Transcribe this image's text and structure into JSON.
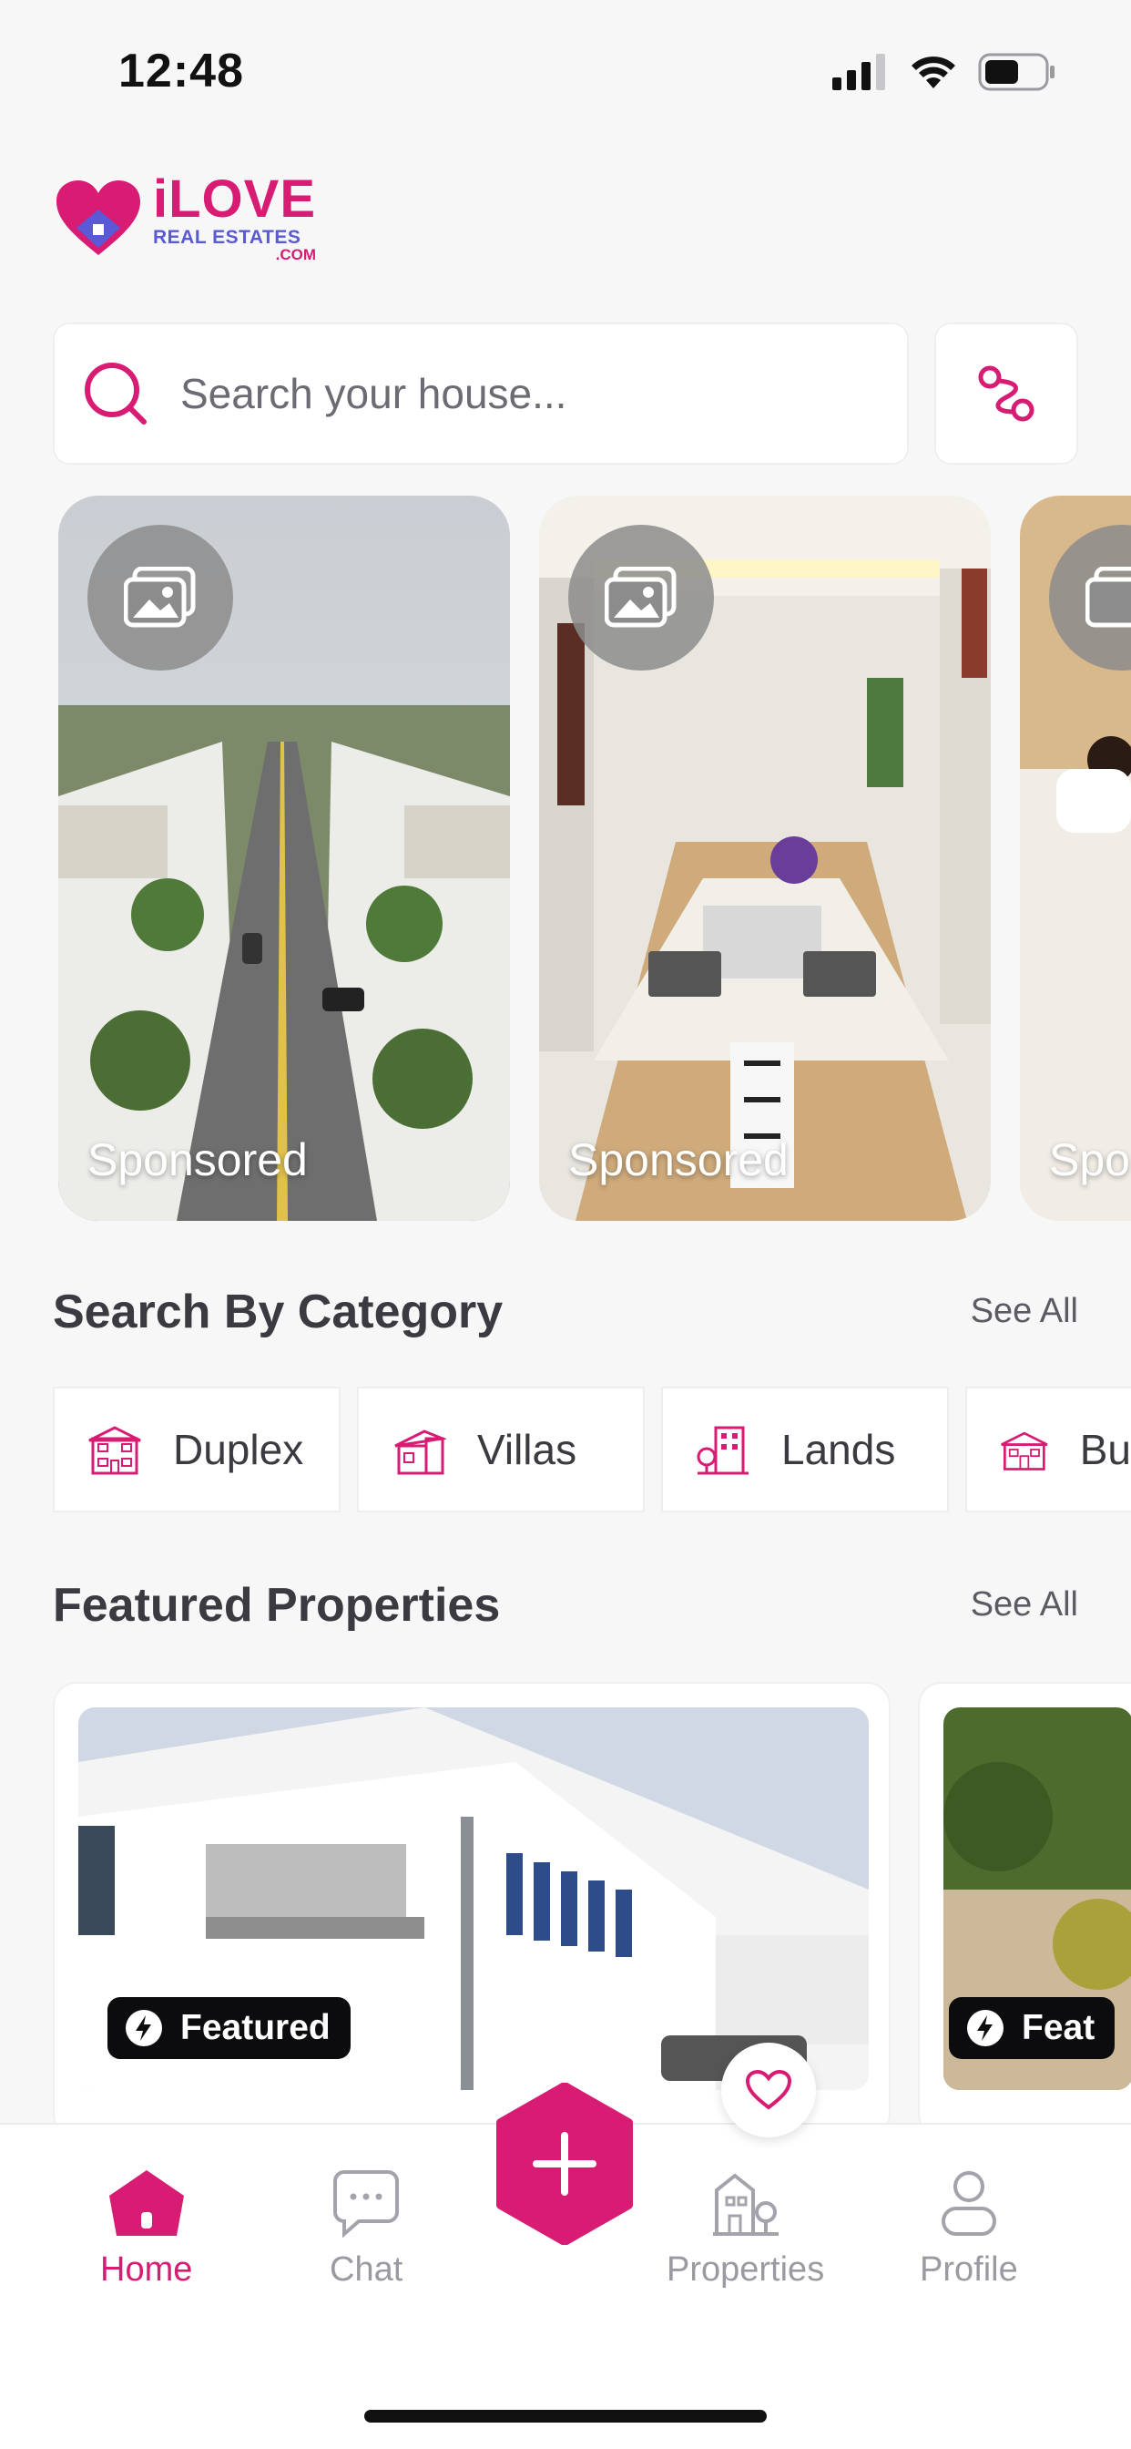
{
  "status_bar": {
    "time": "12:48"
  },
  "brand": {
    "name_main": "iLOVE",
    "name_sub": "REAL ESTATES",
    "name_tld": ".COM",
    "accent": "#d81b73",
    "secondary": "#5a5ad6"
  },
  "search": {
    "placeholder": "Search your house...",
    "icon": "search-icon",
    "filter_icon": "route-icon"
  },
  "sponsored": [
    {
      "label": "Sponsored",
      "icon": "image-icon"
    },
    {
      "label": "Sponsored",
      "icon": "image-icon"
    },
    {
      "label": "Spo",
      "icon": "image-icon"
    }
  ],
  "categories_section": {
    "title": "Search By Category",
    "see_all": "See All",
    "items": [
      {
        "label": "Duplex",
        "icon": "duplex-icon"
      },
      {
        "label": "Villas",
        "icon": "villa-icon"
      },
      {
        "label": "Lands",
        "icon": "land-icon"
      },
      {
        "label": "Bu",
        "icon": "bungalow-icon"
      }
    ]
  },
  "featured_section": {
    "title": "Featured Properties",
    "see_all": "See All",
    "cards": [
      {
        "badge": "Featured",
        "icon": "bolt-icon"
      },
      {
        "badge": "Feat",
        "icon": "bolt-icon"
      }
    ]
  },
  "tab_bar": {
    "items": [
      {
        "label": "Home",
        "icon": "home-icon",
        "active": true
      },
      {
        "label": "Chat",
        "icon": "chat-icon",
        "active": false
      },
      {
        "label": "Properties",
        "icon": "properties-icon",
        "active": false
      },
      {
        "label": "Profile",
        "icon": "profile-icon",
        "active": false
      }
    ],
    "add_icon": "plus-icon"
  }
}
